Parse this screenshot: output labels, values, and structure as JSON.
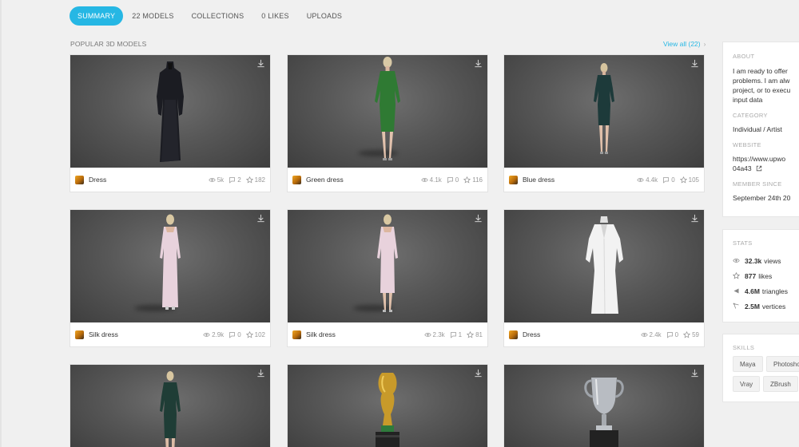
{
  "tabs": [
    {
      "label": "SUMMARY"
    },
    {
      "label": "22 MODELS"
    },
    {
      "label": "COLLECTIONS"
    },
    {
      "label": "0 LIKES"
    },
    {
      "label": "UPLOADS"
    }
  ],
  "section": {
    "title": "POPULAR 3D MODELS",
    "view_all": "View all (22)"
  },
  "models": [
    {
      "name": "Dress",
      "views": "5k",
      "comments": "2",
      "likes": "182"
    },
    {
      "name": "Green dress",
      "views": "4.1k",
      "comments": "0",
      "likes": "116"
    },
    {
      "name": "Blue dress",
      "views": "4.4k",
      "comments": "0",
      "likes": "105"
    },
    {
      "name": "Silk dress",
      "views": "2.9k",
      "comments": "0",
      "likes": "102"
    },
    {
      "name": "Silk dress",
      "views": "2.3k",
      "comments": "1",
      "likes": "81"
    },
    {
      "name": "Dress",
      "views": "2.4k",
      "comments": "0",
      "likes": "59"
    }
  ],
  "about": {
    "label": "ABOUT",
    "lines": [
      "I am ready to offer",
      "problems. I am alw",
      "project, or to execu",
      "input data"
    ],
    "category_label": "CATEGORY",
    "category": "Individual / Artist",
    "website_label": "WEBSITE",
    "website_lines": [
      "https://www.upwo",
      "04a43"
    ],
    "member_label": "MEMBER SINCE",
    "member_since": "September 24th 20"
  },
  "stats": {
    "label": "STATS",
    "views": "32.3k",
    "views_label": "views",
    "likes": "877",
    "likes_label": "likes",
    "triangles": "4.6M",
    "triangles_label": "triangles",
    "vertices": "2.5M",
    "vertices_label": "vertices"
  },
  "skills": {
    "label": "SKILLS",
    "items": [
      "Maya",
      "Photosho",
      "Vray",
      "ZBrush"
    ]
  },
  "colors": {
    "accent": "#26b7e4",
    "viewer_bg": "#575757"
  }
}
